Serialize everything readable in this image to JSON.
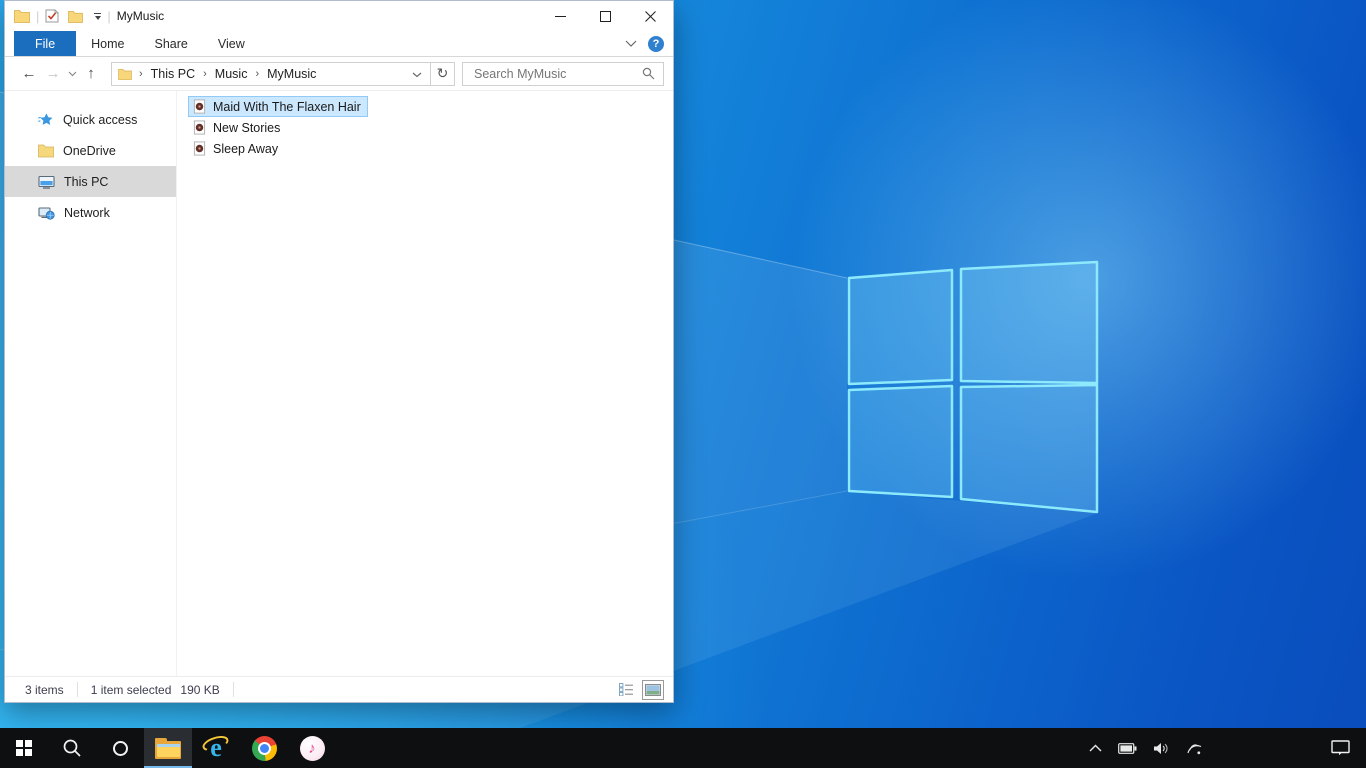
{
  "colors": {
    "accent_blue": "#1b6dbe",
    "selection_bg": "#cce8ff",
    "selection_border": "#91c9f7",
    "sidebar_selected_bg": "#d9d9d9",
    "taskbar_bg": "#0e0f11",
    "wallpaper_light": "#2ba7ea",
    "wallpaper_dark": "#0a4dbc",
    "logo_stroke": "#8deafc"
  },
  "window": {
    "title": "MyMusic",
    "separator": "|",
    "tabs": [
      {
        "label": "File",
        "active": true
      },
      {
        "label": "Home",
        "active": false
      },
      {
        "label": "Share",
        "active": false
      },
      {
        "label": "View",
        "active": false
      }
    ],
    "help_glyph": "?",
    "nav": {
      "back_glyph": "←",
      "forward_glyph": "→",
      "up_glyph": "↑",
      "refresh_glyph": "↻",
      "crumb_sep": "›",
      "breadcrumb": [
        {
          "label": "This PC"
        },
        {
          "label": "Music"
        },
        {
          "label": "MyMusic"
        }
      ],
      "search_placeholder": "Search MyMusic"
    },
    "sidebar": {
      "items": [
        {
          "label": "Quick access",
          "selected": false
        },
        {
          "label": "OneDrive",
          "selected": false
        },
        {
          "label": "This PC",
          "selected": true
        },
        {
          "label": "Network",
          "selected": false
        }
      ]
    },
    "files": [
      {
        "name": "Maid With The Flaxen Hair",
        "selected": true
      },
      {
        "name": "New Stories",
        "selected": false
      },
      {
        "name": "Sleep Away",
        "selected": false
      }
    ],
    "status": {
      "items_count": "3 items",
      "selected_count": "1 item selected",
      "selected_size": "190 KB"
    }
  },
  "taskbar": {
    "apps": [
      {
        "name": "start"
      },
      {
        "name": "search"
      },
      {
        "name": "cortana"
      },
      {
        "name": "file-explorer",
        "active": true
      },
      {
        "name": "internet-explorer"
      },
      {
        "name": "chrome"
      },
      {
        "name": "itunes"
      }
    ],
    "ie_glyph": "e",
    "itunes_glyph": "♪",
    "tray": [
      "hidden-icons",
      "battery",
      "volume",
      "wifi",
      "action-center"
    ]
  }
}
